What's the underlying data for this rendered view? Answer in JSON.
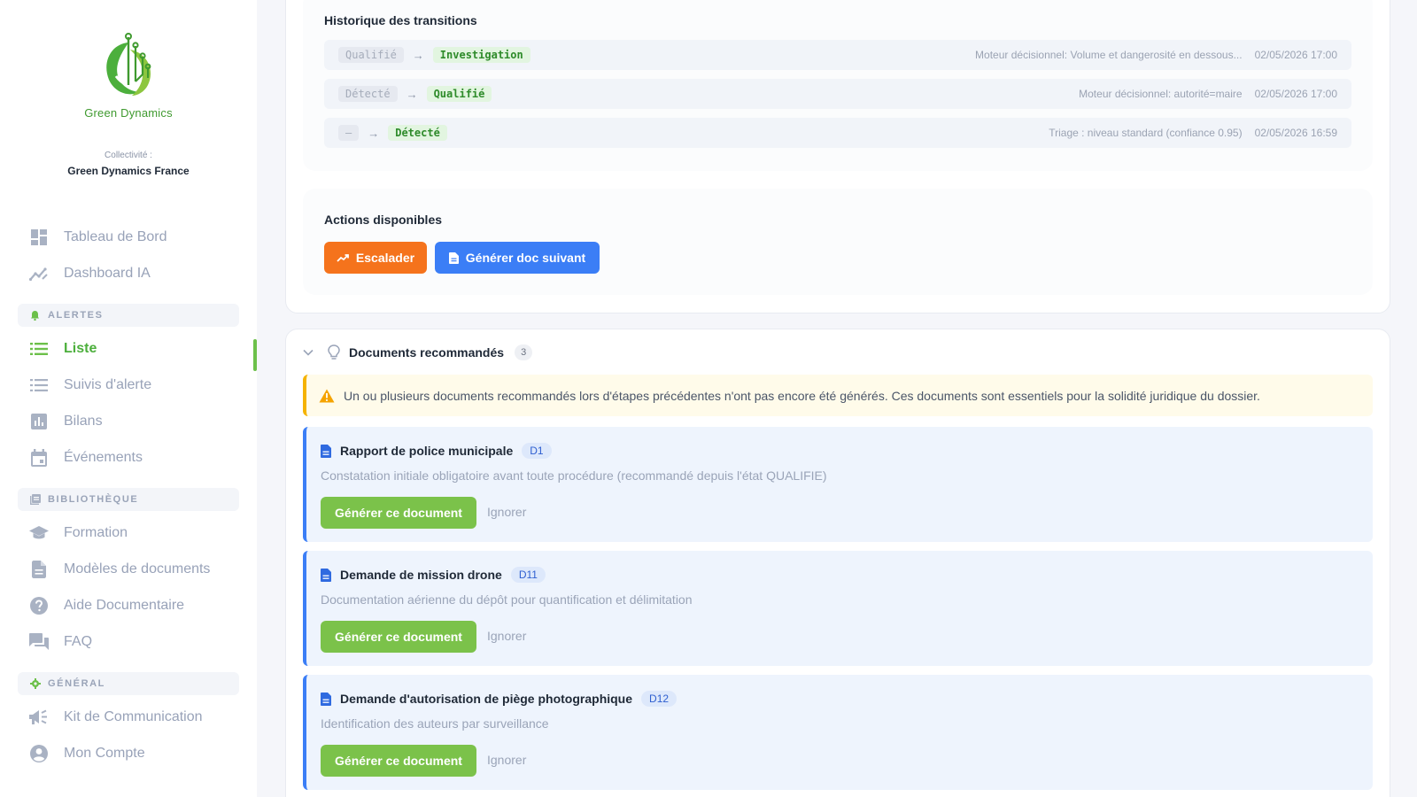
{
  "sidebar": {
    "logo_text": "Green Dynamics",
    "collectivite_label": "Collectivité :",
    "collectivite_name": "Green Dynamics France",
    "items_top": [
      {
        "label": "Tableau de Bord",
        "icon": "dashboard-icon"
      },
      {
        "label": "Dashboard IA",
        "icon": "trending-icon"
      }
    ],
    "sections": [
      {
        "title": "ALERTES",
        "icon": "bell-icon",
        "items": [
          {
            "label": "Liste",
            "icon": "list-icon",
            "active": true
          },
          {
            "label": "Suivis d'alerte",
            "icon": "list-icon"
          },
          {
            "label": "Bilans",
            "icon": "bar-chart-icon"
          },
          {
            "label": "Événements",
            "icon": "calendar-icon"
          }
        ]
      },
      {
        "title": "BIBLIOTHÈQUE",
        "icon": "library-icon",
        "items": [
          {
            "label": "Formation",
            "icon": "graduation-cap-icon"
          },
          {
            "label": "Modèles de documents",
            "icon": "document-icon"
          },
          {
            "label": "Aide Documentaire",
            "icon": "help-icon"
          },
          {
            "label": "FAQ",
            "icon": "forum-icon"
          }
        ]
      },
      {
        "title": "GÉNÉRAL",
        "icon": "gear-icon",
        "items": [
          {
            "label": "Kit de Communication",
            "icon": "megaphone-icon"
          },
          {
            "label": "Mon Compte",
            "icon": "account-icon"
          }
        ]
      }
    ]
  },
  "history": {
    "title": "Historique des transitions",
    "rows": [
      {
        "from": "Qualifié",
        "to": "Investigation",
        "note": "Moteur décisionnel: Volume et dangerosité en dessous...",
        "date": "02/05/2026 17:00"
      },
      {
        "from": "Détecté",
        "to": "Qualifié",
        "note": "Moteur décisionnel: autorité=maire",
        "date": "02/05/2026 17:00"
      },
      {
        "from": "—",
        "to": "Détecté",
        "note": "Triage : niveau standard (confiance 0.95)",
        "date": "02/05/2026 16:59"
      }
    ]
  },
  "actions": {
    "title": "Actions disponibles",
    "escalate_label": "Escalader",
    "generate_next_label": "Générer doc suivant"
  },
  "docs": {
    "title": "Documents recommandés",
    "count": "3",
    "warning": "Un ou plusieurs documents recommandés lors d'étapes précédentes n'ont pas encore été générés. Ces documents sont essentiels pour la solidité juridique du dossier.",
    "generate_label": "Générer ce document",
    "ignore_label": "Ignorer",
    "items": [
      {
        "name": "Rapport de police municipale",
        "code": "D1",
        "desc": "Constatation initiale obligatoire avant toute procédure (recommandé depuis l'état QUALIFIE)"
      },
      {
        "name": "Demande de mission drone",
        "code": "D11",
        "desc": "Documentation aérienne du dépôt pour quantification et délimitation"
      },
      {
        "name": "Demande d'autorisation de piège photographique",
        "code": "D12",
        "desc": "Identification des auteurs par surveillance"
      }
    ]
  },
  "colors": {
    "brand_green": "#6cc04a",
    "orange": "#f5731c",
    "blue": "#3b7ef6",
    "warning": "#f5b300"
  }
}
